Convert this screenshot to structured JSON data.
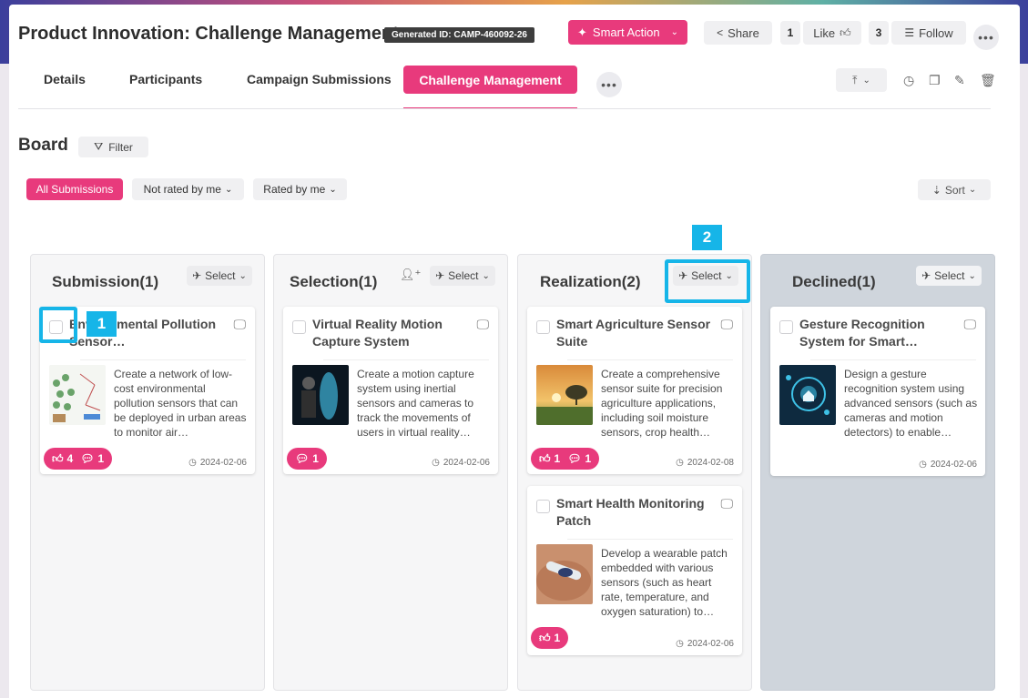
{
  "header": {
    "title": "Product Innovation: Challenge Management",
    "generated_id": "Generated ID: CAMP-460092-26",
    "smart_action": "Smart Action",
    "share": "Share",
    "like_count": "1",
    "like": "Like",
    "follow_count": "3",
    "follow": "Follow"
  },
  "tabs": {
    "details": "Details",
    "participants": "Participants",
    "campaign_submissions": "Campaign Submissions",
    "challenge_management": "Challenge Management"
  },
  "board": {
    "title": "Board",
    "filter": "Filter",
    "all_submissions": "All Submissions",
    "not_rated": "Not rated by me",
    "rated": "Rated by me",
    "sort": "Sort"
  },
  "columns": {
    "submission": {
      "title": "Submission(1)",
      "select": "Select",
      "cards": [
        {
          "title": "Environmental Pollution Sensor…",
          "desc": "Create a network of low-cost environmental pollution sensors that can be deployed in urban areas to monitor air…",
          "likes": "4",
          "comments": "1",
          "date": "2024-02-06"
        }
      ]
    },
    "selection": {
      "title": "Selection(1)",
      "select": "Select",
      "cards": [
        {
          "title": "Virtual Reality Motion Capture System",
          "desc": "Create a motion capture system using inertial sensors and cameras to track the movements of users in virtual reality…",
          "comments": "1",
          "date": "2024-02-06"
        }
      ]
    },
    "realization": {
      "title": "Realization(2)",
      "select": "Select",
      "cards": [
        {
          "title": "Smart Agriculture Sensor Suite",
          "desc": "Create a comprehensive sensor suite for precision agriculture applications, including soil moisture sensors, crop health…",
          "likes": "1",
          "comments": "1",
          "date": "2024-02-08"
        },
        {
          "title": "Smart Health Monitoring Patch",
          "desc": "Develop a wearable patch embedded with various sensors (such as heart rate, temperature, and oxygen saturation) to…",
          "likes": "1",
          "date": "2024-02-06"
        }
      ]
    },
    "declined": {
      "title": "Declined(1)",
      "select": "Select",
      "cards": [
        {
          "title": "Gesture Recognition System for Smart…",
          "desc": "Design a gesture recognition system using advanced sensors (such as cameras and motion detectors) to enable…",
          "date": "2024-02-06"
        }
      ]
    }
  },
  "markers": {
    "one": "1",
    "two": "2"
  },
  "colors": {
    "accent": "#e83a7c",
    "marker": "#16b5e8",
    "declined_bg": "#cfd5dc"
  }
}
